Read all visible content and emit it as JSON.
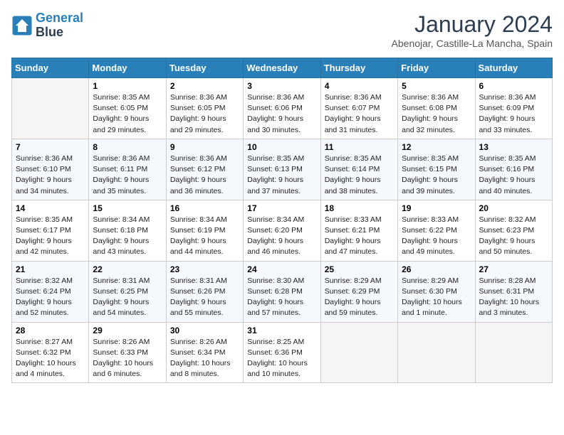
{
  "header": {
    "logo_line1": "General",
    "logo_line2": "Blue",
    "title": "January 2024",
    "subtitle": "Abenojar, Castille-La Mancha, Spain"
  },
  "days_of_week": [
    "Sunday",
    "Monday",
    "Tuesday",
    "Wednesday",
    "Thursday",
    "Friday",
    "Saturday"
  ],
  "weeks": [
    [
      {
        "num": "",
        "empty": true
      },
      {
        "num": "1",
        "sunrise": "Sunrise: 8:35 AM",
        "sunset": "Sunset: 6:05 PM",
        "daylight": "Daylight: 9 hours and 29 minutes."
      },
      {
        "num": "2",
        "sunrise": "Sunrise: 8:36 AM",
        "sunset": "Sunset: 6:05 PM",
        "daylight": "Daylight: 9 hours and 29 minutes."
      },
      {
        "num": "3",
        "sunrise": "Sunrise: 8:36 AM",
        "sunset": "Sunset: 6:06 PM",
        "daylight": "Daylight: 9 hours and 30 minutes."
      },
      {
        "num": "4",
        "sunrise": "Sunrise: 8:36 AM",
        "sunset": "Sunset: 6:07 PM",
        "daylight": "Daylight: 9 hours and 31 minutes."
      },
      {
        "num": "5",
        "sunrise": "Sunrise: 8:36 AM",
        "sunset": "Sunset: 6:08 PM",
        "daylight": "Daylight: 9 hours and 32 minutes."
      },
      {
        "num": "6",
        "sunrise": "Sunrise: 8:36 AM",
        "sunset": "Sunset: 6:09 PM",
        "daylight": "Daylight: 9 hours and 33 minutes."
      }
    ],
    [
      {
        "num": "7",
        "sunrise": "Sunrise: 8:36 AM",
        "sunset": "Sunset: 6:10 PM",
        "daylight": "Daylight: 9 hours and 34 minutes."
      },
      {
        "num": "8",
        "sunrise": "Sunrise: 8:36 AM",
        "sunset": "Sunset: 6:11 PM",
        "daylight": "Daylight: 9 hours and 35 minutes."
      },
      {
        "num": "9",
        "sunrise": "Sunrise: 8:36 AM",
        "sunset": "Sunset: 6:12 PM",
        "daylight": "Daylight: 9 hours and 36 minutes."
      },
      {
        "num": "10",
        "sunrise": "Sunrise: 8:35 AM",
        "sunset": "Sunset: 6:13 PM",
        "daylight": "Daylight: 9 hours and 37 minutes."
      },
      {
        "num": "11",
        "sunrise": "Sunrise: 8:35 AM",
        "sunset": "Sunset: 6:14 PM",
        "daylight": "Daylight: 9 hours and 38 minutes."
      },
      {
        "num": "12",
        "sunrise": "Sunrise: 8:35 AM",
        "sunset": "Sunset: 6:15 PM",
        "daylight": "Daylight: 9 hours and 39 minutes."
      },
      {
        "num": "13",
        "sunrise": "Sunrise: 8:35 AM",
        "sunset": "Sunset: 6:16 PM",
        "daylight": "Daylight: 9 hours and 40 minutes."
      }
    ],
    [
      {
        "num": "14",
        "sunrise": "Sunrise: 8:35 AM",
        "sunset": "Sunset: 6:17 PM",
        "daylight": "Daylight: 9 hours and 42 minutes."
      },
      {
        "num": "15",
        "sunrise": "Sunrise: 8:34 AM",
        "sunset": "Sunset: 6:18 PM",
        "daylight": "Daylight: 9 hours and 43 minutes."
      },
      {
        "num": "16",
        "sunrise": "Sunrise: 8:34 AM",
        "sunset": "Sunset: 6:19 PM",
        "daylight": "Daylight: 9 hours and 44 minutes."
      },
      {
        "num": "17",
        "sunrise": "Sunrise: 8:34 AM",
        "sunset": "Sunset: 6:20 PM",
        "daylight": "Daylight: 9 hours and 46 minutes."
      },
      {
        "num": "18",
        "sunrise": "Sunrise: 8:33 AM",
        "sunset": "Sunset: 6:21 PM",
        "daylight": "Daylight: 9 hours and 47 minutes."
      },
      {
        "num": "19",
        "sunrise": "Sunrise: 8:33 AM",
        "sunset": "Sunset: 6:22 PM",
        "daylight": "Daylight: 9 hours and 49 minutes."
      },
      {
        "num": "20",
        "sunrise": "Sunrise: 8:32 AM",
        "sunset": "Sunset: 6:23 PM",
        "daylight": "Daylight: 9 hours and 50 minutes."
      }
    ],
    [
      {
        "num": "21",
        "sunrise": "Sunrise: 8:32 AM",
        "sunset": "Sunset: 6:24 PM",
        "daylight": "Daylight: 9 hours and 52 minutes."
      },
      {
        "num": "22",
        "sunrise": "Sunrise: 8:31 AM",
        "sunset": "Sunset: 6:25 PM",
        "daylight": "Daylight: 9 hours and 54 minutes."
      },
      {
        "num": "23",
        "sunrise": "Sunrise: 8:31 AM",
        "sunset": "Sunset: 6:26 PM",
        "daylight": "Daylight: 9 hours and 55 minutes."
      },
      {
        "num": "24",
        "sunrise": "Sunrise: 8:30 AM",
        "sunset": "Sunset: 6:28 PM",
        "daylight": "Daylight: 9 hours and 57 minutes."
      },
      {
        "num": "25",
        "sunrise": "Sunrise: 8:29 AM",
        "sunset": "Sunset: 6:29 PM",
        "daylight": "Daylight: 9 hours and 59 minutes."
      },
      {
        "num": "26",
        "sunrise": "Sunrise: 8:29 AM",
        "sunset": "Sunset: 6:30 PM",
        "daylight": "Daylight: 10 hours and 1 minute."
      },
      {
        "num": "27",
        "sunrise": "Sunrise: 8:28 AM",
        "sunset": "Sunset: 6:31 PM",
        "daylight": "Daylight: 10 hours and 3 minutes."
      }
    ],
    [
      {
        "num": "28",
        "sunrise": "Sunrise: 8:27 AM",
        "sunset": "Sunset: 6:32 PM",
        "daylight": "Daylight: 10 hours and 4 minutes."
      },
      {
        "num": "29",
        "sunrise": "Sunrise: 8:26 AM",
        "sunset": "Sunset: 6:33 PM",
        "daylight": "Daylight: 10 hours and 6 minutes."
      },
      {
        "num": "30",
        "sunrise": "Sunrise: 8:26 AM",
        "sunset": "Sunset: 6:34 PM",
        "daylight": "Daylight: 10 hours and 8 minutes."
      },
      {
        "num": "31",
        "sunrise": "Sunrise: 8:25 AM",
        "sunset": "Sunset: 6:36 PM",
        "daylight": "Daylight: 10 hours and 10 minutes."
      },
      {
        "num": "",
        "empty": true
      },
      {
        "num": "",
        "empty": true
      },
      {
        "num": "",
        "empty": true
      }
    ]
  ]
}
